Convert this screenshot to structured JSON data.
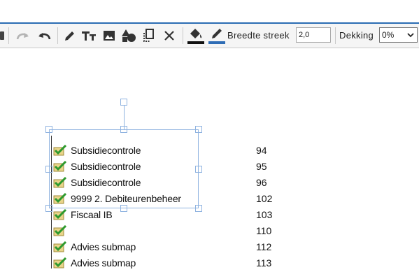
{
  "toolbar": {
    "stroke_width_label": "Breedte streek",
    "stroke_width_value": "2,0",
    "opacity_label": "Dekking",
    "opacity_value": "0%",
    "fill_color": "#111111",
    "stroke_color": "#2f6db5"
  },
  "rows": [
    {
      "name": "Subsidiecontrole",
      "num": "94"
    },
    {
      "name": "Subsidiecontrole",
      "num": "95"
    },
    {
      "name": "Subsidiecontrole",
      "num": "96"
    },
    {
      "name": "9999 2. Debiteurenbeheer",
      "num": "102"
    },
    {
      "name": "Fiscaal IB",
      "num": "103"
    },
    {
      "name": "",
      "num": "110"
    },
    {
      "name": "Advies submap",
      "num": "112"
    },
    {
      "name": "Advies submap",
      "num": "113"
    }
  ]
}
